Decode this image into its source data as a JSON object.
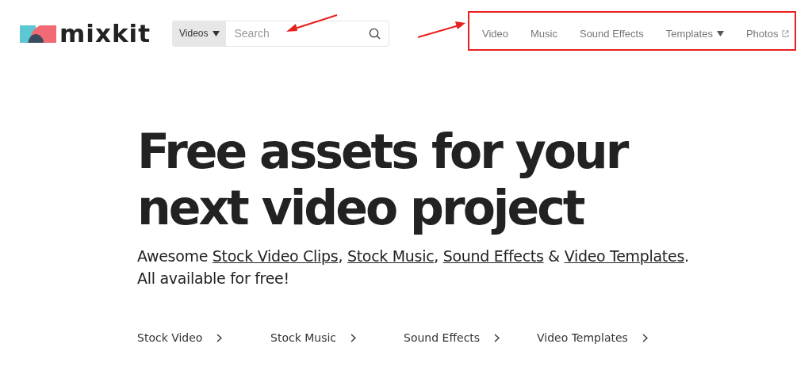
{
  "header": {
    "logo": "mixkit",
    "search": {
      "category": "Videos",
      "placeholder": "Search"
    },
    "nav": [
      {
        "label": "Video",
        "kind": "plain"
      },
      {
        "label": "Music",
        "kind": "plain"
      },
      {
        "label": "Sound Effects",
        "kind": "plain"
      },
      {
        "label": "Templates",
        "kind": "dropdown"
      },
      {
        "label": "Photos",
        "kind": "external"
      }
    ]
  },
  "hero": {
    "headline": [
      "Free assets for your",
      "next video project"
    ],
    "tagline": [
      {
        "text": "Awesome ",
        "link": false
      },
      {
        "text": "Stock Video Clips",
        "link": true
      },
      {
        "text": ", ",
        "link": false
      },
      {
        "text": "Stock Music",
        "link": true
      },
      {
        "text": ", ",
        "link": false
      },
      {
        "text": "Sound Effects",
        "link": true
      },
      {
        "text": " & ",
        "link": false
      },
      {
        "text": "Video Templates",
        "link": true
      },
      {
        "text": ".",
        "link": false
      }
    ],
    "subline": "All available for free!",
    "categories": [
      "Stock Video",
      "Stock Music",
      "Sound Effects",
      "Video Templates"
    ]
  }
}
